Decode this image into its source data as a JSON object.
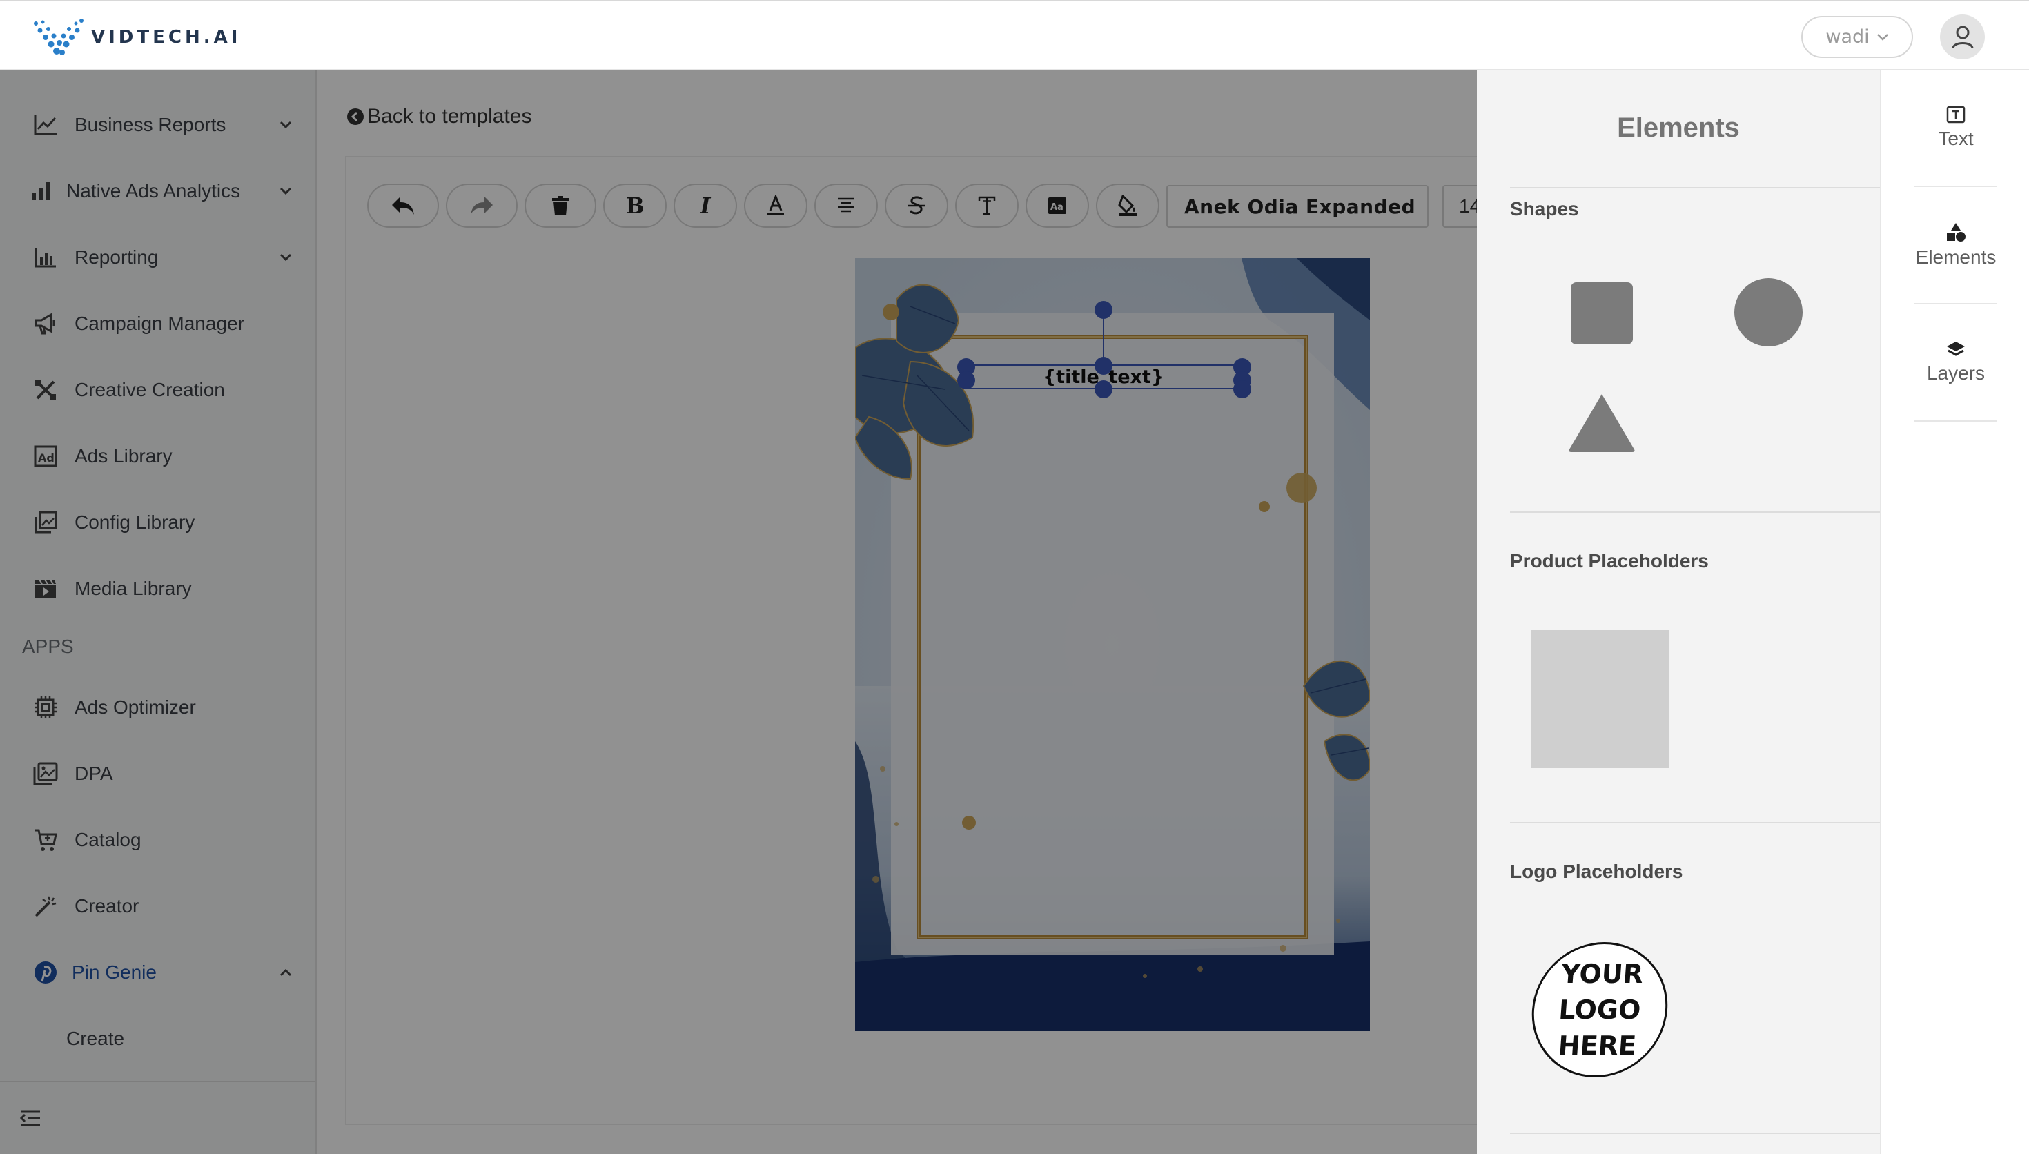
{
  "brand": {
    "name": "VIDTECH.AI"
  },
  "header": {
    "user_name": "wadi"
  },
  "sidebar": {
    "items": [
      {
        "label": "Business Reports",
        "icon": "chart-line-icon",
        "expandable": true,
        "expanded": false
      },
      {
        "label": "Native Ads Analytics",
        "icon": "bar-signal-icon",
        "expandable": true,
        "expanded": false
      },
      {
        "label": "Reporting",
        "icon": "bar-chart-icon",
        "expandable": true,
        "expanded": false
      },
      {
        "label": "Campaign Manager",
        "icon": "megaphone-icon",
        "expandable": false
      },
      {
        "label": "Creative Creation",
        "icon": "tools-icon",
        "expandable": false
      },
      {
        "label": "Ads Library",
        "icon": "ad-icon",
        "expandable": false
      },
      {
        "label": "Config Library",
        "icon": "library-icon",
        "expandable": false
      },
      {
        "label": "Media Library",
        "icon": "clapperboard-icon",
        "expandable": false
      }
    ],
    "apps_label": "APPS",
    "apps": [
      {
        "label": "Ads Optimizer",
        "icon": "chip-icon"
      },
      {
        "label": "DPA",
        "icon": "image-icon"
      },
      {
        "label": "Catalog",
        "icon": "cart-icon"
      },
      {
        "label": "Creator",
        "icon": "magic-wand-icon"
      },
      {
        "label": "Pin Genie",
        "icon": "pinterest-icon",
        "active": true,
        "expanded": true
      }
    ],
    "sub_items": [
      {
        "label": "Create"
      }
    ],
    "accent_color": "#1e4fa3"
  },
  "editor": {
    "back_label": "Back to templates",
    "toolbar": {
      "buttons": [
        {
          "name": "undo",
          "icon": "undo-icon"
        },
        {
          "name": "redo",
          "icon": "redo-icon"
        },
        {
          "name": "delete",
          "icon": "trash-icon"
        },
        {
          "name": "bold",
          "icon": "bold-icon"
        },
        {
          "name": "italic",
          "icon": "italic-icon"
        },
        {
          "name": "text-color",
          "icon": "font-color-icon"
        },
        {
          "name": "align-center",
          "icon": "align-center-icon"
        },
        {
          "name": "strikethrough",
          "icon": "strikethrough-icon"
        },
        {
          "name": "text-style",
          "icon": "text-style-icon"
        },
        {
          "name": "text-effect",
          "icon": "text-effect-icon"
        },
        {
          "name": "fill-color",
          "icon": "paint-bucket-icon"
        }
      ],
      "font_family": "Anek Odia Expanded",
      "font_size": "14"
    },
    "canvas": {
      "title_placeholder": "{title_text}",
      "background": "watercolor floral frame"
    }
  },
  "elements_panel": {
    "title": "Elements",
    "sections": {
      "shapes": "Shapes",
      "product": "Product Placeholders",
      "logo": "Logo Placeholders"
    },
    "logo_placeholder_text": [
      "YOUR",
      "LOGO",
      "HERE"
    ]
  },
  "tabs": [
    {
      "label": "Text",
      "icon": "text-box-icon"
    },
    {
      "label": "Elements",
      "icon": "shapes-icon"
    },
    {
      "label": "Layers",
      "icon": "layers-icon"
    }
  ]
}
